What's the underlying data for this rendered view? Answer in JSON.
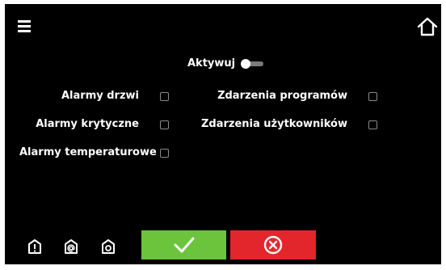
{
  "header": {
    "menu_icon": "hamburger-menu-icon",
    "home_icon": "home-icon"
  },
  "activate": {
    "label": "Aktywuj",
    "toggle_state": "off"
  },
  "options": {
    "door_alarms": {
      "label": "Alarmy drzwi",
      "checked": false
    },
    "critical_alarms": {
      "label": "Alarmy krytyczne",
      "checked": false
    },
    "temperature_alarms": {
      "label": "Alarmy temperaturowe",
      "checked": false
    },
    "program_events": {
      "label": "Zdarzenia programów",
      "checked": false
    },
    "user_events": {
      "label": "Zdarzenia użytkowników",
      "checked": false
    }
  },
  "footer": {
    "icons": [
      "alert-icon",
      "email-at-icon",
      "camera-icon"
    ],
    "confirm_icon": "checkmark-icon",
    "cancel_icon": "cancel-circle-x-icon"
  },
  "colors": {
    "background": "#000000",
    "text": "#ffffff",
    "confirm": "#6cc43c",
    "cancel": "#e3262c",
    "checkbox_border": "#8a8a8a"
  }
}
